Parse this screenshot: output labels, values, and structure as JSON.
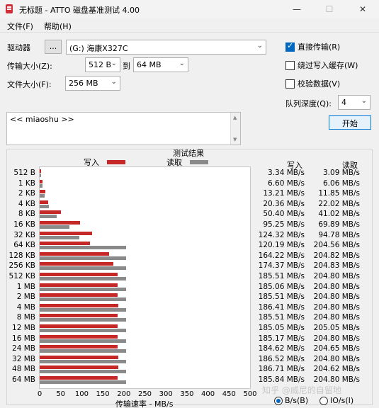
{
  "window": {
    "title": "无标题 - ATTO 磁盘基准测试 4.00",
    "min_icon": "minimize-icon",
    "max_icon": "maximize-icon",
    "close_icon": "close-icon"
  },
  "menu": [
    "文件(F)",
    "帮助(H)"
  ],
  "form": {
    "drive_label": "驱动器",
    "browse_label": "...",
    "drive_value": "(G:) 海康X327C",
    "transfer_label": "传输大小(Z):",
    "transfer_from": "512 B",
    "to_label": "到",
    "transfer_to": "64 MB",
    "filesize_label": "文件大小(F):",
    "filesize_value": "256 MB",
    "direct_io": {
      "label": "直接传输(R)",
      "checked": true
    },
    "bypass_cache": {
      "label": "绕过写入缓存(W)",
      "checked": false
    },
    "verify": {
      "label": "校验数据(V)",
      "checked": false
    },
    "queue_label": "队列深度(Q):",
    "queue_value": "4",
    "start_label": "开始",
    "description": "<< miaoshu >>"
  },
  "results": {
    "title": "测试结果",
    "legend_write": "写入",
    "legend_read": "读取",
    "col_write": "写入",
    "col_read": "读取",
    "xlabel": "传输速率 - MB/s",
    "colors": {
      "write": "#c62828",
      "read": "#8a8a8a"
    }
  },
  "chart_data": {
    "type": "bar",
    "orientation": "horizontal",
    "title": "测试结果",
    "xlabel": "传输速率 - MB/s",
    "xlim": [
      0,
      500
    ],
    "xticks": [
      0,
      50,
      100,
      150,
      200,
      250,
      300,
      350,
      400,
      450,
      500
    ],
    "categories": [
      "512 B",
      "1 KB",
      "2 KB",
      "4 KB",
      "8 KB",
      "16 KB",
      "32 KB",
      "64 KB",
      "128 KB",
      "256 KB",
      "512 KB",
      "1 MB",
      "2 MB",
      "4 MB",
      "8 MB",
      "12 MB",
      "16 MB",
      "24 MB",
      "32 MB",
      "48 MB",
      "64 MB"
    ],
    "series": [
      {
        "name": "写入",
        "values": [
          3.34,
          6.6,
          13.21,
          20.36,
          50.4,
          95.25,
          124.32,
          120.19,
          164.22,
          174.37,
          185.51,
          185.06,
          185.51,
          186.41,
          185.51,
          185.05,
          185.17,
          184.62,
          186.52,
          186.71,
          185.84
        ],
        "labels": [
          "3.34 MB/s",
          "6.60 MB/s",
          "13.21 MB/s",
          "20.36 MB/s",
          "50.40 MB/s",
          "95.25 MB/s",
          "124.32 MB/s",
          "120.19 MB/s",
          "164.22 MB/s",
          "174.37 MB/s",
          "185.51 MB/s",
          "185.06 MB/s",
          "185.51 MB/s",
          "186.41 MB/s",
          "185.51 MB/s",
          "185.05 MB/s",
          "185.17 MB/s",
          "184.62 MB/s",
          "186.52 MB/s",
          "186.71 MB/s",
          "185.84 MB/s"
        ]
      },
      {
        "name": "读取",
        "values": [
          3.09,
          6.06,
          11.85,
          22.02,
          41.02,
          69.89,
          94.78,
          204.56,
          204.82,
          204.83,
          204.8,
          204.8,
          204.8,
          204.8,
          204.8,
          205.05,
          204.8,
          204.65,
          204.8,
          204.62,
          204.8
        ],
        "labels": [
          "3.09 MB/s",
          "6.06 MB/s",
          "11.85 MB/s",
          "22.02 MB/s",
          "41.02 MB/s",
          "69.89 MB/s",
          "94.78 MB/s",
          "204.56 MB/s",
          "204.82 MB/s",
          "204.83 MB/s",
          "204.80 MB/s",
          "204.80 MB/s",
          "204.80 MB/s",
          "204.80 MB/s",
          "204.80 MB/s",
          "205.05 MB/s",
          "204.80 MB/s",
          "204.65 MB/s",
          "204.80 MB/s",
          "204.62 MB/s",
          "204.80 MB/s"
        ]
      }
    ]
  },
  "units": {
    "bytes_label": "B/s(B)",
    "io_label": "IO/s(I)",
    "selected": "bytes"
  },
  "watermark": "知乎 @威尼的自留地"
}
